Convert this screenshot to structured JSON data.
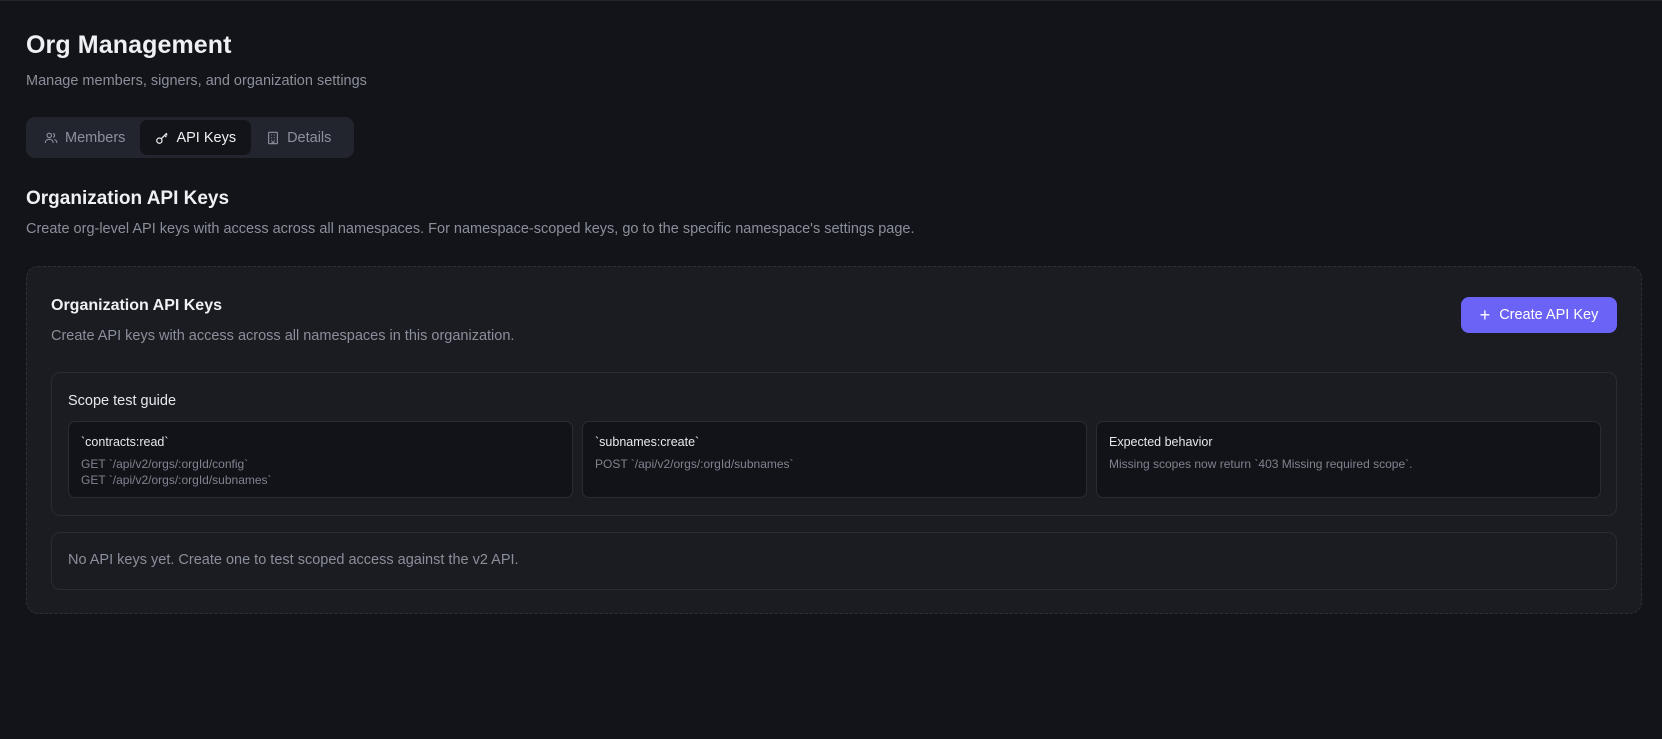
{
  "header": {
    "title": "Org Management",
    "subtitle": "Manage members, signers, and organization settings"
  },
  "tabs": [
    {
      "label": "Members",
      "icon": "users-icon",
      "active": false
    },
    {
      "label": "API Keys",
      "icon": "key-icon",
      "active": true
    },
    {
      "label": "Details",
      "icon": "building-icon",
      "active": false
    }
  ],
  "section": {
    "title": "Organization API Keys",
    "description": "Create org-level API keys with access across all namespaces. For namespace-scoped keys, go to the specific namespace's settings page."
  },
  "card": {
    "title": "Organization API Keys",
    "description": "Create API keys with access across all namespaces in this organization.",
    "create_button": "Create API Key"
  },
  "guide": {
    "title": "Scope test guide",
    "columns": [
      {
        "head": "`contracts:read`",
        "lines": [
          "GET `/api/v2/orgs/:orgId/config`",
          "GET `/api/v2/orgs/:orgId/subnames`"
        ]
      },
      {
        "head": "`subnames:create`",
        "lines": [
          "POST `/api/v2/orgs/:orgId/subnames`"
        ]
      },
      {
        "head": "Expected behavior",
        "lines": [
          "Missing scopes now return `403 Missing required scope`."
        ]
      }
    ]
  },
  "empty_state": "No API keys yet. Create one to test scoped access against the v2 API.",
  "colors": {
    "background": "#131419",
    "card": "#1a1c22",
    "accent": "#6b63f5",
    "muted_text": "#8b8f9b"
  }
}
